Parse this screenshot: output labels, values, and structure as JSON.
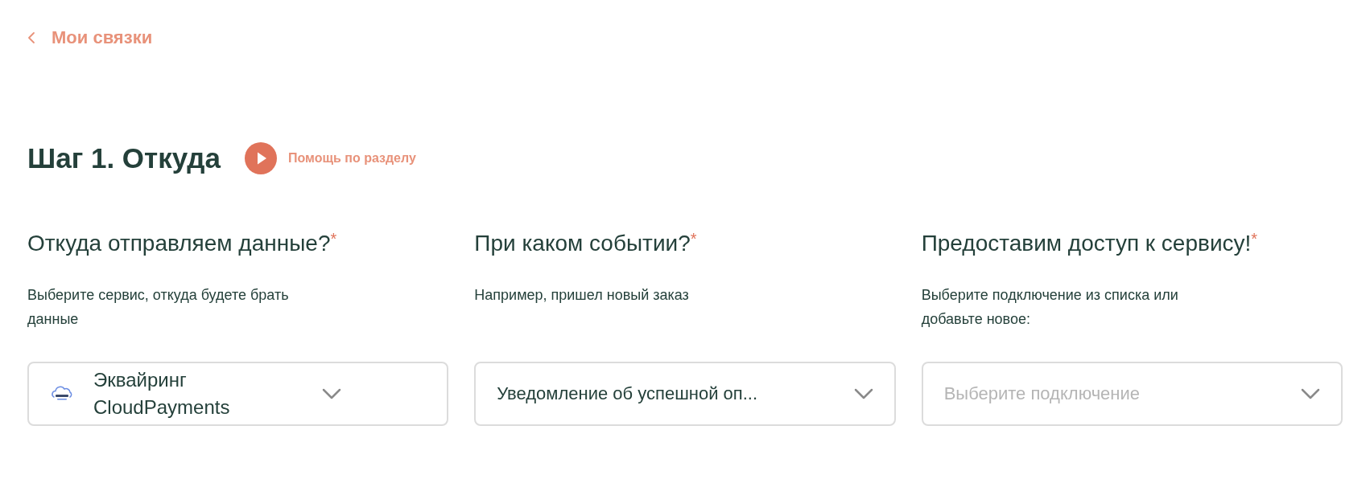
{
  "back_link": {
    "label": "Мои связки"
  },
  "step": {
    "title": "Шаг 1. Откуда",
    "help": "Помощь по разделу"
  },
  "fields": [
    {
      "kind": "logo_select",
      "question": "Откуда отправляем данные?",
      "required_mark": "*",
      "hint": "Выберите сервис, откуда будете брать данные",
      "value": "Эквайринг CloudPayments"
    },
    {
      "kind": "select",
      "question": "При каком событии?",
      "required_mark": "*",
      "hint": "Например, пришел новый заказ",
      "value": "Уведомление об успешной оп..."
    },
    {
      "kind": "select",
      "question": "Предоставим доступ к сервису!",
      "required_mark": "*",
      "hint": "Выберите подключение из списка или добавьте новое:",
      "placeholder": "Выберите подключение"
    }
  ]
}
